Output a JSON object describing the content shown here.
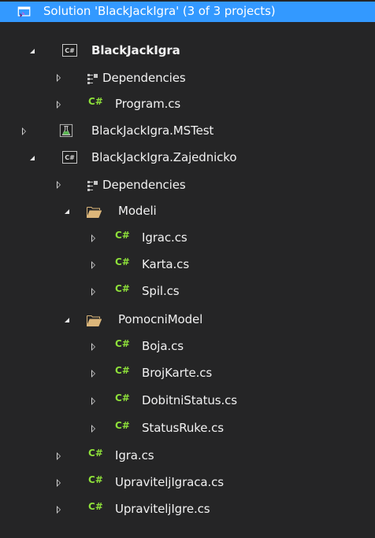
{
  "solution": {
    "label": "Solution 'BlackJackIgra' (3 of 3 projects)"
  },
  "projects": {
    "p1": {
      "label": "BlackJackIgra",
      "icon_text": "C#"
    },
    "p1_deps": "Dependencies",
    "p1_program": "Program.cs",
    "p2": {
      "label": "BlackJackIgra.MSTest"
    },
    "p3": {
      "label": "BlackJackIgra.Zajednicko",
      "icon_text": "C#"
    },
    "p3_deps": "Dependencies",
    "modeli": "Modeli",
    "igrac": "Igrac.cs",
    "karta": "Karta.cs",
    "spil": "Spil.cs",
    "pomocni": "PomocniModel",
    "boja": "Boja.cs",
    "brojkarte": "BrojKarte.cs",
    "dobitni": "DobitniStatus.cs",
    "statusruke": "StatusRuke.cs",
    "igra": "Igra.cs",
    "upr_igraca": "UpraviteljIgraca.cs",
    "upr_igre": "UpraviteljIgre.cs"
  },
  "icons": {
    "cs_glyph": "C#"
  },
  "colors": {
    "background": "#252526",
    "selection": "#3399ff",
    "cs_file_green": "#8ee03a",
    "folder_yellow": "#dcb67a",
    "test_green": "#5ab552"
  }
}
